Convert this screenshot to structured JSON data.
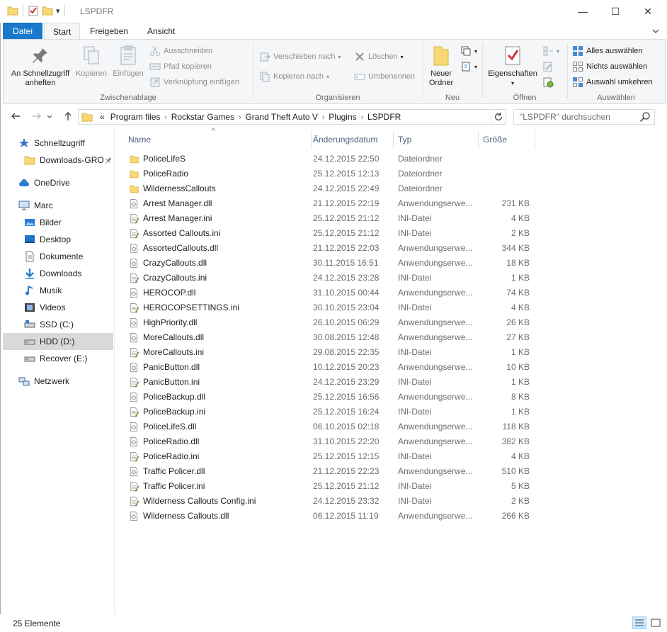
{
  "window": {
    "title": "LSPDFR",
    "minimize_symbol": "—",
    "maximize_symbol": "☐",
    "close_symbol": "✕",
    "qat_dropdown": "▾"
  },
  "ribbon_tabs": {
    "file": "Datei",
    "home": "Start",
    "share": "Freigeben",
    "view": "Ansicht"
  },
  "ribbon": {
    "clipboard": {
      "label": "Zwischenablage",
      "pin_line1": "An Schnellzugriff",
      "pin_line2": "anheften",
      "copy": "Kopieren",
      "paste": "Einfügen",
      "cut": "Ausschneiden",
      "copy_path": "Pfad kopieren",
      "paste_shortcut": "Verknüpfung einfügen"
    },
    "organize": {
      "label": "Organisieren",
      "move_to": "Verschieben nach",
      "copy_to": "Kopieren nach",
      "delete": "Löschen",
      "rename": "Umbenennen"
    },
    "new": {
      "label": "Neu",
      "new_folder_line1": "Neuer",
      "new_folder_line2": "Ordner"
    },
    "open": {
      "label": "Öffnen",
      "properties": "Eigenschaften"
    },
    "select": {
      "label": "Auswählen",
      "select_all": "Alles auswählen",
      "select_none": "Nichts auswählen",
      "invert": "Auswahl umkehren"
    }
  },
  "address": {
    "overflow": "«",
    "crumbs": [
      "Program files",
      "Rockstar Games",
      "Grand Theft Auto V",
      "Plugins",
      "LSPDFR"
    ],
    "search_placeholder": "\"LSPDFR\" durchsuchen"
  },
  "nav": {
    "quick_access": "Schnellzugriff",
    "downloads_pinned": "Downloads-GRO",
    "onedrive": "OneDrive",
    "this_pc": "Marc",
    "pictures": "Bilder",
    "desktop": "Desktop",
    "documents": "Dokumente",
    "downloads": "Downloads",
    "music": "Musik",
    "videos": "Videos",
    "ssd": "SSD (C:)",
    "hdd": "HDD (D:)",
    "recover": "Recover (E:)",
    "network": "Netzwerk"
  },
  "columns": {
    "name": "Name",
    "date": "Änderungsdatum",
    "type": "Typ",
    "size": "Größe",
    "sort_indicator": "^"
  },
  "files": [
    {
      "name": "PoliceLifeS",
      "date": "24.12.2015 22:50",
      "type": "Dateiordner",
      "size": "",
      "kind": "folder"
    },
    {
      "name": "PoliceRadio",
      "date": "25.12.2015 12:13",
      "type": "Dateiordner",
      "size": "",
      "kind": "folder"
    },
    {
      "name": "WildernessCallouts",
      "date": "24.12.2015 22:49",
      "type": "Dateiordner",
      "size": "",
      "kind": "folder"
    },
    {
      "name": "Arrest Manager.dll",
      "date": "21.12.2015 22:19",
      "type": "Anwendungserwe...",
      "size": "231 KB",
      "kind": "dll"
    },
    {
      "name": "Arrest Manager.ini",
      "date": "25.12.2015 21:12",
      "type": "INI-Datei",
      "size": "4 KB",
      "kind": "ini"
    },
    {
      "name": "Assorted Callouts.ini",
      "date": "25.12.2015 21:12",
      "type": "INI-Datei",
      "size": "2 KB",
      "kind": "ini"
    },
    {
      "name": "AssortedCallouts.dll",
      "date": "21.12.2015 22:03",
      "type": "Anwendungserwe...",
      "size": "344 KB",
      "kind": "dll"
    },
    {
      "name": "CrazyCallouts.dll",
      "date": "30.11.2015 16:51",
      "type": "Anwendungserwe...",
      "size": "18 KB",
      "kind": "dll"
    },
    {
      "name": "CrazyCallouts.ini",
      "date": "24.12.2015 23:28",
      "type": "INI-Datei",
      "size": "1 KB",
      "kind": "ini"
    },
    {
      "name": "HEROCOP.dll",
      "date": "31.10.2015 00:44",
      "type": "Anwendungserwe...",
      "size": "74 KB",
      "kind": "dll"
    },
    {
      "name": "HEROCOPSETTINGS.ini",
      "date": "30.10.2015 23:04",
      "type": "INI-Datei",
      "size": "4 KB",
      "kind": "ini"
    },
    {
      "name": "HighPriority.dll",
      "date": "26.10.2015 06:29",
      "type": "Anwendungserwe...",
      "size": "26 KB",
      "kind": "dll"
    },
    {
      "name": "MoreCallouts.dll",
      "date": "30.08.2015 12:48",
      "type": "Anwendungserwe...",
      "size": "27 KB",
      "kind": "dll"
    },
    {
      "name": "MoreCallouts.ini",
      "date": "29.08.2015 22:35",
      "type": "INI-Datei",
      "size": "1 KB",
      "kind": "ini"
    },
    {
      "name": "PanicButton.dll",
      "date": "10.12.2015 20:23",
      "type": "Anwendungserwe...",
      "size": "10 KB",
      "kind": "dll"
    },
    {
      "name": "PanicButton.ini",
      "date": "24.12.2015 23:29",
      "type": "INI-Datei",
      "size": "1 KB",
      "kind": "ini"
    },
    {
      "name": "PoliceBackup.dll",
      "date": "25.12.2015 16:56",
      "type": "Anwendungserwe...",
      "size": "8 KB",
      "kind": "dll"
    },
    {
      "name": "PoliceBackup.ini",
      "date": "25.12.2015 16:24",
      "type": "INI-Datei",
      "size": "1 KB",
      "kind": "ini"
    },
    {
      "name": "PoliceLifeS.dll",
      "date": "06.10.2015 02:18",
      "type": "Anwendungserwe...",
      "size": "118 KB",
      "kind": "dll"
    },
    {
      "name": "PoliceRadio.dll",
      "date": "31.10.2015 22:20",
      "type": "Anwendungserwe...",
      "size": "382 KB",
      "kind": "dll"
    },
    {
      "name": "PoliceRadio.ini",
      "date": "25.12.2015 12:15",
      "type": "INI-Datei",
      "size": "4 KB",
      "kind": "ini"
    },
    {
      "name": "Traffic Policer.dll",
      "date": "21.12.2015 22:23",
      "type": "Anwendungserwe...",
      "size": "510 KB",
      "kind": "dll"
    },
    {
      "name": "Traffic Policer.ini",
      "date": "25.12.2015 21:12",
      "type": "INI-Datei",
      "size": "5 KB",
      "kind": "ini"
    },
    {
      "name": "Wilderness Callouts Config.ini",
      "date": "24.12.2015 23:32",
      "type": "INI-Datei",
      "size": "2 KB",
      "kind": "ini"
    },
    {
      "name": "Wilderness Callouts.dll",
      "date": "06.12.2015 11:19",
      "type": "Anwendungserwe...",
      "size": "266 KB",
      "kind": "dll"
    }
  ],
  "status": {
    "item_count": "25 Elemente"
  },
  "colors": {
    "file_tab": "#1979ca",
    "ribbon_bg": "#f5f6f7",
    "selected_nav": "#d9d9d9",
    "folder": "#f8d775",
    "header_text": "#4c607a"
  }
}
